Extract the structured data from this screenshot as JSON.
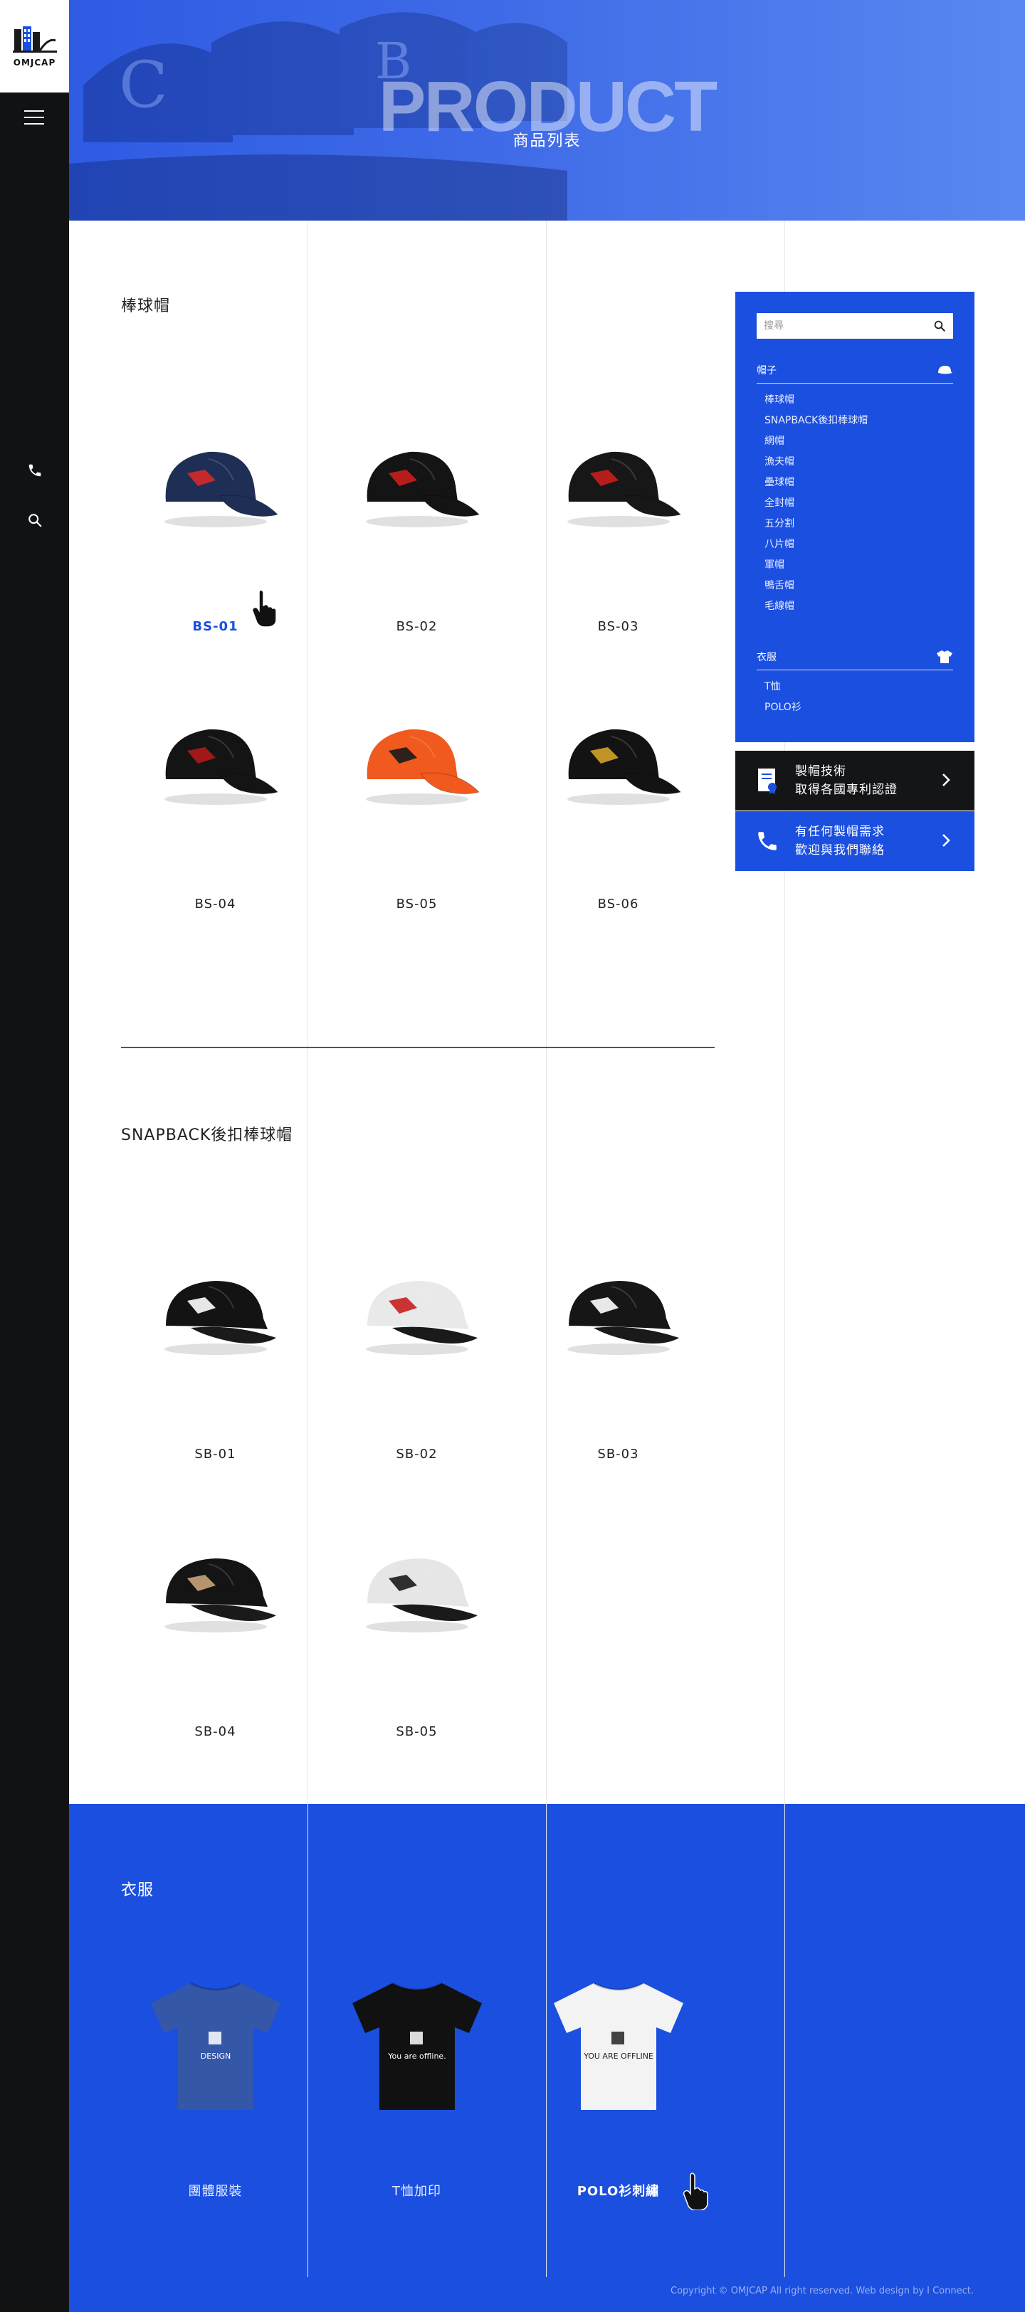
{
  "brand": {
    "logo_text": "OMJCAP"
  },
  "hero": {
    "title": "PRODUCT",
    "subtitle": "商品列表"
  },
  "sections": {
    "baseball": {
      "title": "棒球帽",
      "items": [
        {
          "label": "BS-01",
          "color": "#1f2e54",
          "accent": "#d42a2a",
          "active": true
        },
        {
          "label": "BS-02",
          "color": "#141414",
          "accent": "#c81e1e"
        },
        {
          "label": "BS-03",
          "color": "#171717",
          "accent": "#c81e1e"
        },
        {
          "label": "BS-04",
          "color": "#141414",
          "accent": "#b01818"
        },
        {
          "label": "BS-05",
          "color": "#f05a1e",
          "accent": "#1a1a1a"
        },
        {
          "label": "BS-06",
          "color": "#131313",
          "accent": "#d4a22a"
        }
      ]
    },
    "snapback": {
      "title": "SNAPBACK後扣棒球帽",
      "items": [
        {
          "label": "SB-01",
          "color": "#131313",
          "accent": "#ffffff"
        },
        {
          "label": "SB-02",
          "color": "#e9e9e9",
          "accent": "#c81e1e"
        },
        {
          "label": "SB-03",
          "color": "#161616",
          "accent": "#ffffff"
        },
        {
          "label": "SB-04",
          "color": "#141414",
          "accent": "#c7a27a"
        },
        {
          "label": "SB-05",
          "color": "#e6e6e6",
          "accent": "#1a1a1a"
        }
      ]
    },
    "clothes": {
      "title": "衣服",
      "items": [
        {
          "label": "團體服裝",
          "color": "#3557a8",
          "print": "DESIGN"
        },
        {
          "label": "T恤加印",
          "color": "#111111",
          "print": "You are offline."
        },
        {
          "label": "POLO衫刺繡",
          "color": "#f3f3f3",
          "print": "YOU ARE OFFLINE",
          "active": true
        }
      ]
    }
  },
  "panel": {
    "search_placeholder": "搜尋",
    "categories": [
      {
        "name": "帽子",
        "icon": "cap-icon",
        "items": [
          "棒球帽",
          "SNAPBACK後扣棒球帽",
          "網帽",
          "漁夫帽",
          "壘球帽",
          "全封帽",
          "五分割",
          "八片帽",
          "軍帽",
          "鴨舌帽",
          "毛線帽"
        ]
      },
      {
        "name": "衣服",
        "icon": "tshirt-icon",
        "items": [
          "T恤",
          "POLO衫"
        ]
      }
    ]
  },
  "cta": {
    "patent": {
      "line1": "製帽技術",
      "line2": "取得各國專利認證",
      "icon": "certificate-icon"
    },
    "contact": {
      "line1": "有任何製帽需求",
      "line2": "歡迎與我們聯絡",
      "icon": "phone-icon"
    }
  },
  "footer": {
    "copyright": "Copyright © OMJCAP All right reserved. Web design by I Connect."
  },
  "colors": {
    "brand_blue": "#1a4fe0",
    "sidebar": "#111214"
  }
}
